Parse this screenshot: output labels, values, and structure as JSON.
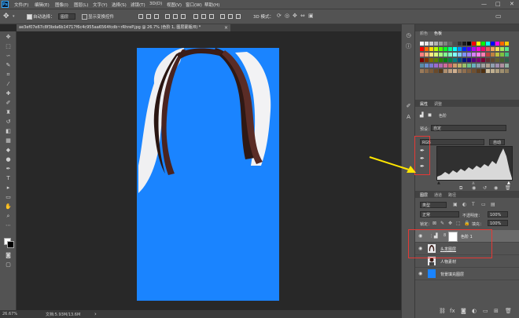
{
  "menubar": {
    "logo": "Ps",
    "items": [
      "文件(F)",
      "编辑(E)",
      "图像(I)",
      "图层(L)",
      "文字(Y)",
      "选择(S)",
      "滤镜(T)",
      "3D(D)",
      "视图(V)",
      "窗口(W)",
      "帮助(H)"
    ],
    "minimize": "—",
    "maximize": "□",
    "close": "✕"
  },
  "options": {
    "auto_select_label": "自动选择：",
    "auto_select_value": "图层",
    "show_transform_label": "显示变换控件",
    "three_d_mode": "3D 模式："
  },
  "document": {
    "tab_title": "ae3ef07e67c8f3bda6b14717f6c4c955aa6564fcdb~rRhreP.jpg @ 26.7% (色阶 1, 图层蒙版/8) *",
    "tab_close": "×"
  },
  "statusbar": {
    "zoom": "26.67%",
    "doc_size": "文档:5.93M/13.6M",
    "arrow": "›"
  },
  "color_panel": {
    "tabs": [
      "颜色",
      "色板"
    ]
  },
  "properties_panel": {
    "tabs": [
      "属性",
      "调整"
    ],
    "type_label": "色阶",
    "preset_label": "预设：",
    "preset_value": "自定",
    "channel_value": "RGB",
    "auto_button": "自动"
  },
  "layers_panel": {
    "tabs": [
      "图层",
      "通道",
      "路径"
    ],
    "filter_kind": "类型",
    "blend_mode": "正常",
    "opacity_label": "不透明度：",
    "opacity_value": "100%",
    "lock_label": "锁定：",
    "fill_label": "填充：",
    "fill_value": "100%",
    "layers": [
      {
        "name": "色阶 1",
        "type": "adjustment",
        "selected": true
      },
      {
        "name": "头发图层",
        "type": "image",
        "selected": false
      },
      {
        "name": "人物素材",
        "type": "image",
        "selected": false
      },
      {
        "name": "背景填充图层",
        "type": "fill",
        "selected": false
      }
    ]
  },
  "colors": {
    "canvas_blue": "#1a84ff",
    "ui_gray": "#535353",
    "annotation_red": "#e53935",
    "arrow_yellow": "#ffe600"
  }
}
